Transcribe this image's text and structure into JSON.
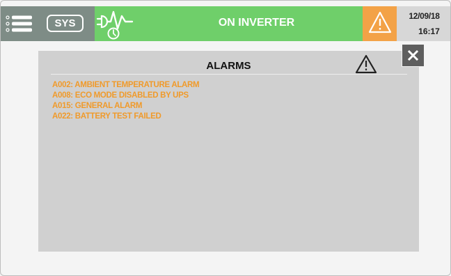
{
  "topbar": {
    "sys_label": "SYS",
    "status_text": "ON INVERTER",
    "date": "12/09/18",
    "time": "16:17",
    "colors": {
      "menu_bg": "#7e8c86",
      "status_bg": "#6fcf6a",
      "warning_bg": "#f3a247",
      "datetime_bg": "#d7d7d7"
    },
    "icons": {
      "menu": "list-menu-icon",
      "status": "inverter-waveform-clock-icon",
      "warning": "warning-triangle-icon"
    }
  },
  "alarms_panel": {
    "title": "ALARMS",
    "title_icon": "warning-triangle-icon",
    "close_icon": "close-icon",
    "alarm_color": "#f09a2a",
    "items": [
      "A002: AMBIENT TEMPERATURE ALARM",
      "A008: ECO MODE DISABLED BY UPS",
      "A015: GENERAL ALARM",
      "A022: BATTERY TEST FAILED"
    ]
  }
}
